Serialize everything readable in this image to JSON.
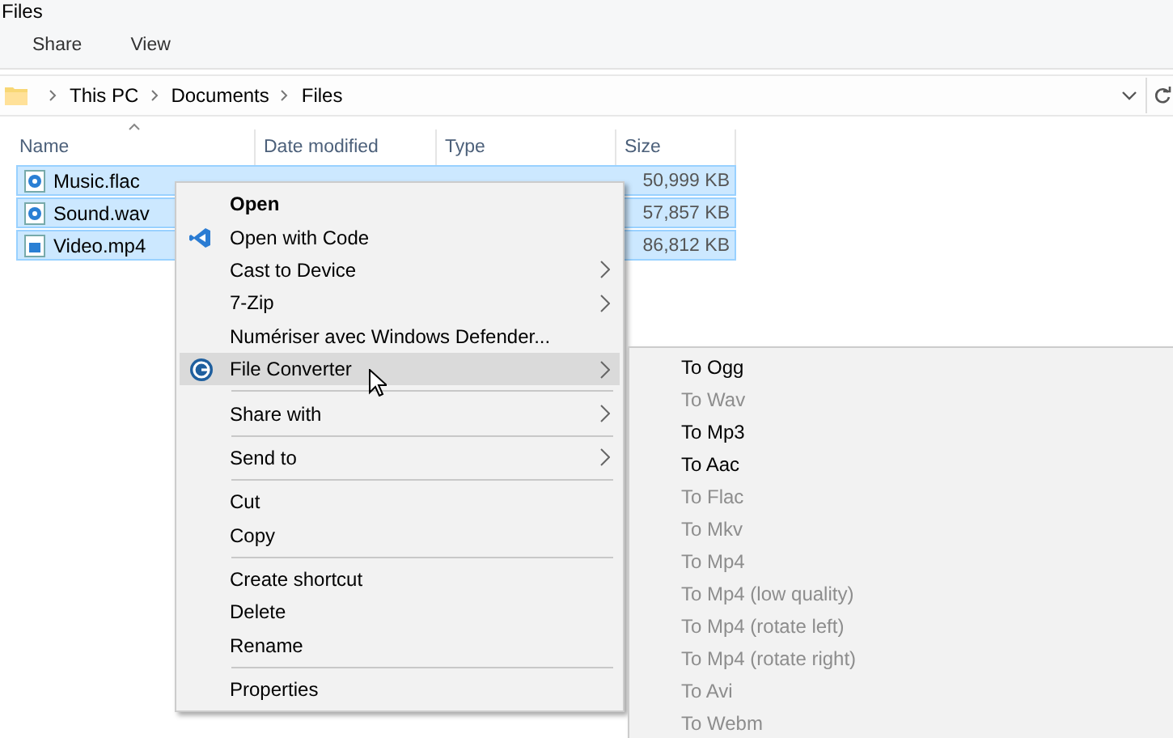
{
  "window": {
    "title": "Files"
  },
  "ribbon_tabs": [
    {
      "label": "Share"
    },
    {
      "label": "View"
    }
  ],
  "address_bar": {
    "crumbs": [
      "This PC",
      "Documents",
      "Files"
    ]
  },
  "table": {
    "columns": [
      "Name",
      "Date modified",
      "Type",
      "Size"
    ],
    "rows": [
      {
        "name": "Music.flac",
        "size": "50,999 KB",
        "selected": true,
        "kind": "audio"
      },
      {
        "name": "Sound.wav",
        "size": "57,857 KB",
        "selected": true,
        "kind": "audio"
      },
      {
        "name": "Video.mp4",
        "size": "86,812 KB",
        "selected": true,
        "kind": "video"
      }
    ]
  },
  "context_menu": {
    "items": [
      {
        "kind": "item",
        "label": "Open",
        "bold": true
      },
      {
        "kind": "code_item",
        "label": "Open with Code"
      },
      {
        "kind": "item",
        "label": "Cast to Device",
        "submenu": true
      },
      {
        "kind": "item",
        "label": "7-Zip",
        "submenu": true
      },
      {
        "kind": "item",
        "label": "Numériser avec Windows Defender..."
      },
      {
        "kind": "converter_item",
        "label": "File Converter",
        "submenu": true,
        "highlighted": true
      },
      {
        "kind": "separator"
      },
      {
        "kind": "item",
        "label": "Share with",
        "submenu": true
      },
      {
        "kind": "separator"
      },
      {
        "kind": "item",
        "label": "Send to",
        "submenu": true
      },
      {
        "kind": "separator"
      },
      {
        "kind": "item",
        "label": "Cut"
      },
      {
        "kind": "item",
        "label": "Copy"
      },
      {
        "kind": "separator"
      },
      {
        "kind": "item",
        "label": "Create shortcut"
      },
      {
        "kind": "item",
        "label": "Delete"
      },
      {
        "kind": "item",
        "label": "Rename"
      },
      {
        "kind": "separator"
      },
      {
        "kind": "item",
        "label": "Properties"
      }
    ]
  },
  "submenu": {
    "items": [
      {
        "label": "To Ogg",
        "disabled": false
      },
      {
        "label": "To Wav",
        "disabled": true
      },
      {
        "label": "To Mp3",
        "disabled": false
      },
      {
        "label": "To Aac",
        "disabled": false
      },
      {
        "label": "To Flac",
        "disabled": true
      },
      {
        "label": "To Mkv",
        "disabled": true
      },
      {
        "label": "To Mp4",
        "disabled": true
      },
      {
        "label": "To Mp4 (low quality)",
        "disabled": true
      },
      {
        "label": "To Mp4 (rotate left)",
        "disabled": true
      },
      {
        "label": "To Mp4 (rotate right)",
        "disabled": true
      },
      {
        "label": "To Avi",
        "disabled": true
      },
      {
        "label": "To Webm",
        "disabled": true
      }
    ]
  }
}
